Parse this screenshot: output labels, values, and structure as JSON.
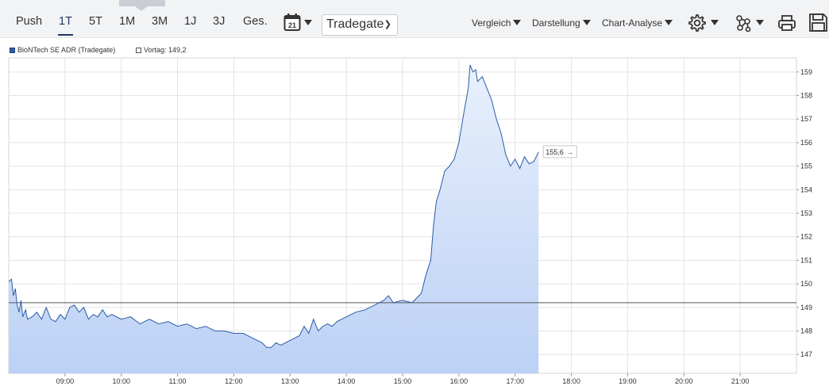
{
  "toolbar": {
    "tabs": [
      {
        "label": "Push",
        "active": false
      },
      {
        "label": "1T",
        "active": true
      },
      {
        "label": "5T",
        "active": false
      },
      {
        "label": "1M",
        "active": false
      },
      {
        "label": "3M",
        "active": false
      },
      {
        "label": "1J",
        "active": false
      },
      {
        "label": "3J",
        "active": false
      },
      {
        "label": "Ges.",
        "active": false
      }
    ],
    "calendar_icon": "calendar-icon",
    "calendar_number": "21",
    "exchange_select": "Tradegate",
    "menus": [
      "Vergleich",
      "Darstellung",
      "Chart-Analyse"
    ],
    "icons": [
      "gear-icon",
      "network-icon",
      "print-icon",
      "save-icon"
    ]
  },
  "colors": {
    "line": "#2b5ba8",
    "fill_top": "#e8f0fc",
    "fill_bottom": "#bcd1f5",
    "grid": "#e3e3e3",
    "prev_close": "#555555"
  },
  "chart_data": {
    "type": "area",
    "legend": {
      "series_label": "BioNTech SE ADR (Tradegate)",
      "prev_close_label": "Vortag: 149,2"
    },
    "last_value_label": "155,6",
    "prev_close": 149.2,
    "ylim": [
      146.2,
      159.6
    ],
    "y_ticks": [
      147,
      148,
      149,
      150,
      151,
      152,
      153,
      154,
      155,
      156,
      157,
      158,
      159
    ],
    "x_range": [
      "08:00",
      "21:59"
    ],
    "x_ticks": [
      "09:00",
      "10:00",
      "11:00",
      "12:00",
      "13:00",
      "14:00",
      "15:00",
      "16:00",
      "17:00",
      "18:00",
      "19:00",
      "20:00",
      "21:00"
    ],
    "grid": true,
    "series": [
      {
        "name": "BioNTech SE ADR (Tradegate)",
        "points": [
          [
            "08:00",
            150.1
          ],
          [
            "08:03",
            150.2
          ],
          [
            "08:05",
            149.5
          ],
          [
            "08:07",
            149.8
          ],
          [
            "08:09",
            149.1
          ],
          [
            "08:11",
            148.8
          ],
          [
            "08:13",
            149.3
          ],
          [
            "08:15",
            148.6
          ],
          [
            "08:18",
            148.9
          ],
          [
            "08:20",
            148.5
          ],
          [
            "08:25",
            148.6
          ],
          [
            "08:30",
            148.8
          ],
          [
            "08:35",
            148.5
          ],
          [
            "08:40",
            149.0
          ],
          [
            "08:45",
            148.5
          ],
          [
            "08:50",
            148.4
          ],
          [
            "08:55",
            148.7
          ],
          [
            "09:00",
            148.5
          ],
          [
            "09:05",
            149.0
          ],
          [
            "09:10",
            149.1
          ],
          [
            "09:15",
            148.8
          ],
          [
            "09:20",
            149.0
          ],
          [
            "09:25",
            148.5
          ],
          [
            "09:30",
            148.7
          ],
          [
            "09:35",
            148.6
          ],
          [
            "09:40",
            148.9
          ],
          [
            "09:45",
            148.6
          ],
          [
            "09:50",
            148.7
          ],
          [
            "10:00",
            148.5
          ],
          [
            "10:10",
            148.6
          ],
          [
            "10:20",
            148.3
          ],
          [
            "10:30",
            148.5
          ],
          [
            "10:40",
            148.3
          ],
          [
            "10:50",
            148.4
          ],
          [
            "11:00",
            148.2
          ],
          [
            "11:10",
            148.3
          ],
          [
            "11:20",
            148.1
          ],
          [
            "11:30",
            148.2
          ],
          [
            "11:40",
            148.0
          ],
          [
            "11:50",
            148.0
          ],
          [
            "12:00",
            147.9
          ],
          [
            "12:10",
            147.9
          ],
          [
            "12:20",
            147.7
          ],
          [
            "12:30",
            147.5
          ],
          [
            "12:35",
            147.3
          ],
          [
            "12:40",
            147.3
          ],
          [
            "12:45",
            147.5
          ],
          [
            "12:50",
            147.4
          ],
          [
            "13:00",
            147.6
          ],
          [
            "13:10",
            147.8
          ],
          [
            "13:15",
            148.2
          ],
          [
            "13:20",
            147.9
          ],
          [
            "13:25",
            148.5
          ],
          [
            "13:30",
            148.0
          ],
          [
            "13:35",
            148.2
          ],
          [
            "13:40",
            148.3
          ],
          [
            "13:45",
            148.2
          ],
          [
            "13:50",
            148.4
          ],
          [
            "14:00",
            148.6
          ],
          [
            "14:10",
            148.8
          ],
          [
            "14:20",
            148.9
          ],
          [
            "14:30",
            149.1
          ],
          [
            "14:40",
            149.3
          ],
          [
            "14:45",
            149.5
          ],
          [
            "14:50",
            149.2
          ],
          [
            "15:00",
            149.3
          ],
          [
            "15:10",
            149.2
          ],
          [
            "15:15",
            149.4
          ],
          [
            "15:20",
            149.6
          ],
          [
            "15:25",
            150.4
          ],
          [
            "15:30",
            151.0
          ],
          [
            "15:33",
            152.5
          ],
          [
            "15:36",
            153.5
          ],
          [
            "15:40",
            154.0
          ],
          [
            "15:45",
            154.8
          ],
          [
            "15:50",
            155.0
          ],
          [
            "15:55",
            155.3
          ],
          [
            "16:00",
            156.0
          ],
          [
            "16:05",
            157.2
          ],
          [
            "16:10",
            158.3
          ],
          [
            "16:12",
            159.3
          ],
          [
            "16:15",
            159.0
          ],
          [
            "16:18",
            159.1
          ],
          [
            "16:20",
            158.6
          ],
          [
            "16:25",
            158.8
          ],
          [
            "16:30",
            158.3
          ],
          [
            "16:35",
            157.8
          ],
          [
            "16:40",
            157.0
          ],
          [
            "16:45",
            156.4
          ],
          [
            "16:50",
            155.5
          ],
          [
            "16:55",
            155.0
          ],
          [
            "17:00",
            155.3
          ],
          [
            "17:05",
            154.9
          ],
          [
            "17:10",
            155.4
          ],
          [
            "17:15",
            155.1
          ],
          [
            "17:20",
            155.2
          ],
          [
            "17:25",
            155.6
          ]
        ]
      }
    ]
  }
}
